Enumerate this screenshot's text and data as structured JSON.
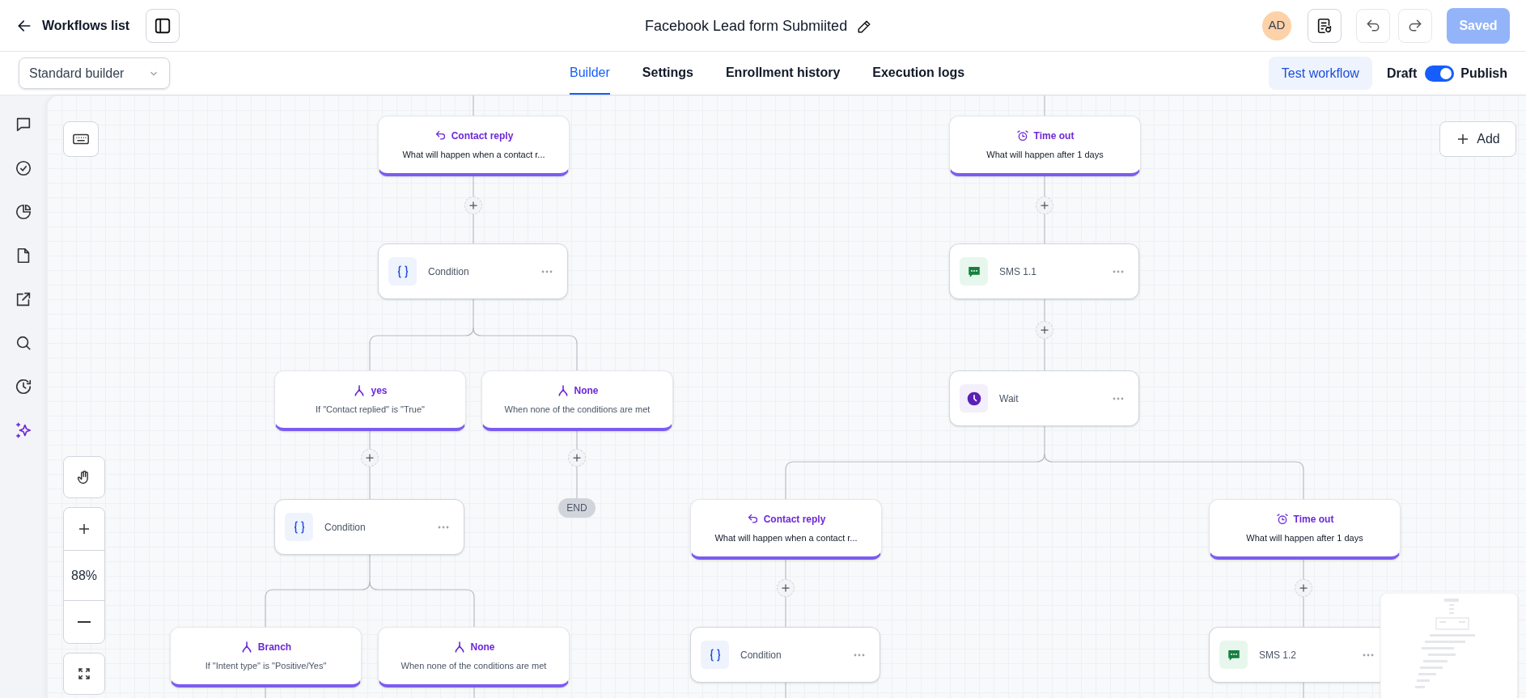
{
  "header": {
    "back_label": "Workflows list",
    "title": "Facebook Lead form Submiited",
    "avatar": "AD",
    "save_button": {
      "label": "Saved",
      "disabled": true
    }
  },
  "toolbar": {
    "builder_select": "Standard builder",
    "tabs": [
      {
        "label": "Builder",
        "selected": true
      },
      {
        "label": "Settings",
        "selected": false
      },
      {
        "label": "Enrollment history",
        "selected": false
      },
      {
        "label": "Execution logs",
        "selected": false
      }
    ],
    "test_button": "Test workflow",
    "publish_toggle": {
      "off_label": "Draft",
      "on_label": "Publish",
      "on": true
    }
  },
  "canvas": {
    "add_button": "Add",
    "zoom": "88%",
    "end_label": "END",
    "nodes": [
      {
        "kind": "reply",
        "title": "Contact reply",
        "subtitle": "What will happen when a contact r..."
      },
      {
        "kind": "timeout",
        "title": "Time out",
        "subtitle": "What will happen after 1 days"
      },
      {
        "kind": "condition",
        "label": "Condition"
      },
      {
        "kind": "sms",
        "label": "SMS 1.1"
      },
      {
        "kind": "branch",
        "title": "yes",
        "subtitle": "If \"Contact replied\" is \"True\""
      },
      {
        "kind": "branch",
        "title": "None",
        "subtitle": "When none of the conditions are met"
      },
      {
        "kind": "wait",
        "label": "Wait"
      },
      {
        "kind": "condition",
        "label": "Condition"
      },
      {
        "kind": "reply",
        "title": "Contact reply",
        "subtitle": "What will happen when a contact r..."
      },
      {
        "kind": "timeout",
        "title": "Time out",
        "subtitle": "What will happen after 1 days"
      },
      {
        "kind": "branch",
        "title": "Branch",
        "subtitle": "If \"Intent type\" is \"Positive/Yes\""
      },
      {
        "kind": "branch",
        "title": "None",
        "subtitle": "When none of the conditions are met"
      },
      {
        "kind": "condition",
        "label": "Condition"
      },
      {
        "kind": "sms",
        "label": "SMS 1.2"
      }
    ]
  }
}
